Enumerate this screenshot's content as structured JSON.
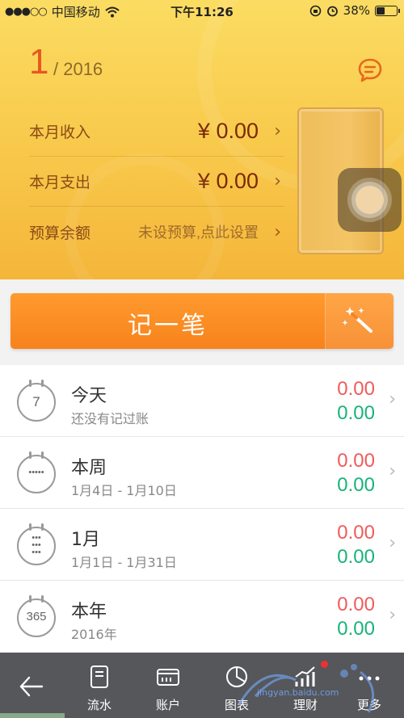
{
  "status_bar": {
    "carrier": "中国移动",
    "time": "下午11:26",
    "battery": "38%",
    "battery_level": 0.38
  },
  "header": {
    "month": "1",
    "year": "/ 2016",
    "rows": [
      {
        "label": "本月收入",
        "value": "¥ 0.00"
      },
      {
        "label": "本月支出",
        "value": "¥ 0.00"
      },
      {
        "label": "预算余额",
        "value": "未设预算,点此设置"
      }
    ]
  },
  "record_button": {
    "label": "记一笔"
  },
  "periods": [
    {
      "icon": "calendar-day-icon",
      "icon_text": "7",
      "title": "今天",
      "subtitle": "还没有记过账",
      "income": "0.00",
      "expense": "0.00"
    },
    {
      "icon": "calendar-week-icon",
      "icon_text": "•••••",
      "title": "本周",
      "subtitle": "1月4日 - 1月10日",
      "income": "0.00",
      "expense": "0.00"
    },
    {
      "icon": "calendar-month-icon",
      "icon_text": "•••",
      "title": "1月",
      "subtitle": "1月1日 - 1月31日",
      "income": "0.00",
      "expense": "0.00"
    },
    {
      "icon": "calendar-year-icon",
      "icon_text": "365",
      "title": "本年",
      "subtitle": "2016年",
      "income": "0.00",
      "expense": "0.00"
    }
  ],
  "colors": {
    "income": "#ef5b5b",
    "expense": "#19b37a",
    "accent": "#f7821c",
    "month_number": "#e8561f"
  },
  "tabbar": {
    "tabs": [
      {
        "label": "流水",
        "icon": "ledger-icon"
      },
      {
        "label": "账户",
        "icon": "wallet-icon"
      },
      {
        "label": "图表",
        "icon": "pie-chart-icon"
      },
      {
        "label": "理财",
        "icon": "bar-trend-icon"
      },
      {
        "label": "更多",
        "icon": "more-dots-icon"
      }
    ]
  },
  "watermark": {
    "text": "jingyan.baidu.com"
  }
}
